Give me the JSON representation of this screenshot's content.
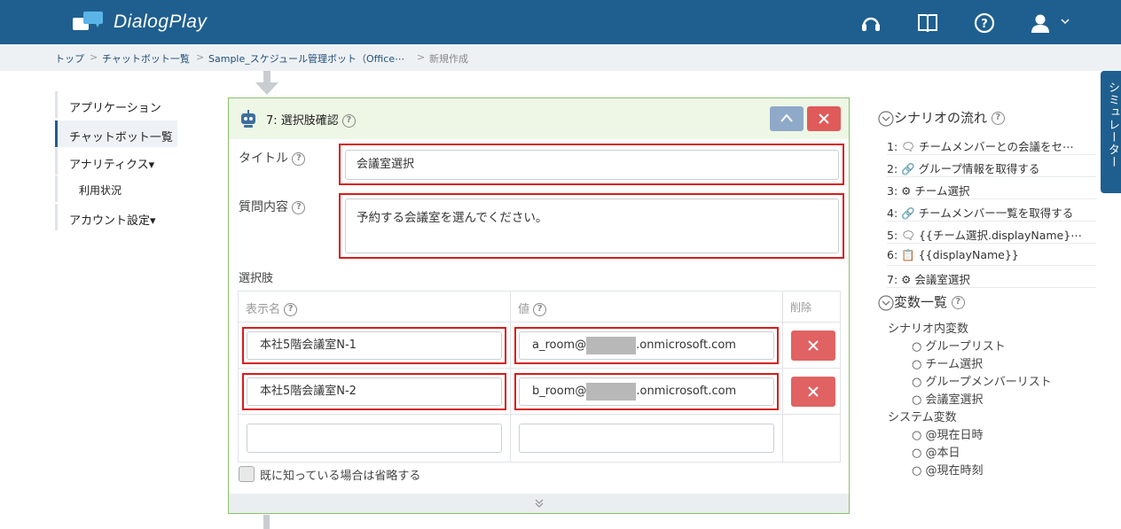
{
  "app": {
    "name": "DialogPlay"
  },
  "header": {
    "icons": [
      "headset-icon",
      "book-icon",
      "help-icon",
      "user-icon",
      "caret-down-icon"
    ]
  },
  "breadcrumb": [
    "トップ",
    "チャットボット一覧",
    "Sample_スケジュール管理ボット（Office⋯",
    "新規作成"
  ],
  "sidebar": {
    "items": [
      {
        "label": "アプリケーション"
      },
      {
        "label": "チャットボット一覧"
      },
      {
        "label": "アナリティクス▾"
      },
      {
        "label": "利用状況"
      },
      {
        "label": "アカウント設定▾"
      }
    ]
  },
  "panel": {
    "title": "7: 選択肢確認",
    "title_field": {
      "label": "タイトル",
      "value": "会議室選択"
    },
    "question_field": {
      "label": "質問内容",
      "value": "予約する会議室を選んでください。"
    },
    "choices_label": "選択肢",
    "columns": {
      "display": "表示名",
      "value": "値",
      "delete": "削除"
    },
    "rows": [
      {
        "display": "本社5階会議室N-1",
        "value_prefix": "a_room@",
        "value_suffix": ".onmicrosoft.com"
      },
      {
        "display": "本社5階会議室N-2",
        "value_prefix": "b_room@",
        "value_suffix": ".onmicrosoft.com"
      }
    ],
    "skip_label": "既に知っている場合は省略する"
  },
  "scenario": {
    "heading": "シナリオの流れ",
    "items": [
      "1: 🗨 チームメンバーとの会議をセ⋯",
      "2: 🔗 グループ情報を取得する",
      "3: ⚙ チーム選択",
      "4: 🔗 チームメンバー一覧を取得する",
      "5: 🗨 {{チーム選択.displayName}⋯",
      "6: 📋 {{displayName}}",
      "7: ⚙ 会議室選択"
    ]
  },
  "variables": {
    "heading": "変数一覧",
    "scenario_label": "シナリオ内変数",
    "scenario_vars": [
      "グループリスト",
      "チーム選択",
      "グループメンバーリスト",
      "会議室選択"
    ],
    "system_label": "システム変数",
    "system_vars": [
      "@現在日時",
      "@本日",
      "@現在時刻"
    ]
  },
  "simulator": {
    "label": "シミュレーター"
  },
  "colors": {
    "header": "#1f5f8f",
    "highlight": "#d81c1c",
    "panel_border": "#8cc06a",
    "delete": "#e06262"
  }
}
